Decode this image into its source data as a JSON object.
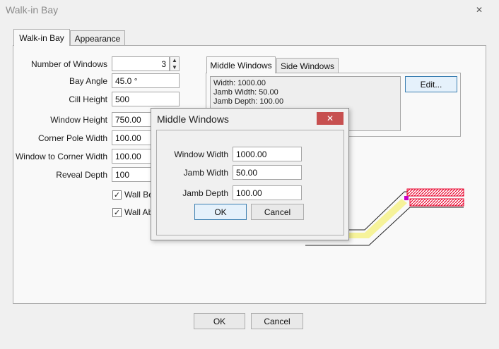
{
  "window": {
    "title": "Walk-in Bay",
    "close_glyph": "✕"
  },
  "tabs": [
    {
      "label": "Walk-in Bay",
      "active": true
    },
    {
      "label": "Appearance",
      "active": false
    }
  ],
  "fields": {
    "number_of_windows": {
      "label": "Number of Windows",
      "value": "3"
    },
    "bay_angle": {
      "label": "Bay Angle",
      "value": "45.0 °"
    },
    "cill_height": {
      "label": "Cill Height",
      "value": "500"
    },
    "window_height": {
      "label": "Window Height",
      "value": "750.00"
    },
    "corner_pole_width": {
      "label": "Corner Pole Width",
      "value": "100.00"
    },
    "window_to_corner_width": {
      "label": "Window to Corner Width",
      "value": "100.00"
    },
    "reveal_depth": {
      "label": "Reveal Depth",
      "value": "100"
    }
  },
  "checkboxes": [
    {
      "label": "Wall Bel",
      "checked": true,
      "glyph": "✓"
    },
    {
      "label": "Wall Abo",
      "checked": true,
      "glyph": "✓"
    }
  ],
  "spinner": {
    "up": "▲",
    "down": "▼"
  },
  "window_tabs": [
    {
      "label": "Middle Windows",
      "active": true
    },
    {
      "label": "Side Windows",
      "active": false
    }
  ],
  "summary_lines": [
    "Width: 1000.00",
    "Jamb Width: 50.00",
    "Jamb Depth: 100.00"
  ],
  "edit_button": "Edit...",
  "footer": {
    "ok": "OK",
    "cancel": "Cancel"
  },
  "dialog": {
    "title": "Middle Windows",
    "close_glyph": "✕",
    "fields": {
      "window_width": {
        "label": "Window Width",
        "value": "1000.00"
      },
      "jamb_width": {
        "label": "Jamb Width",
        "value": "50.00"
      },
      "jamb_depth": {
        "label": "Jamb Depth",
        "value": "100.00"
      }
    },
    "ok": "OK",
    "cancel": "Cancel"
  },
  "colors": {
    "preview_hatch": "#e8002a",
    "preview_glass": "#f6f39a",
    "preview_outline": "#222222",
    "focus_border": "#3c7fb1",
    "close_button": "#c75050"
  }
}
